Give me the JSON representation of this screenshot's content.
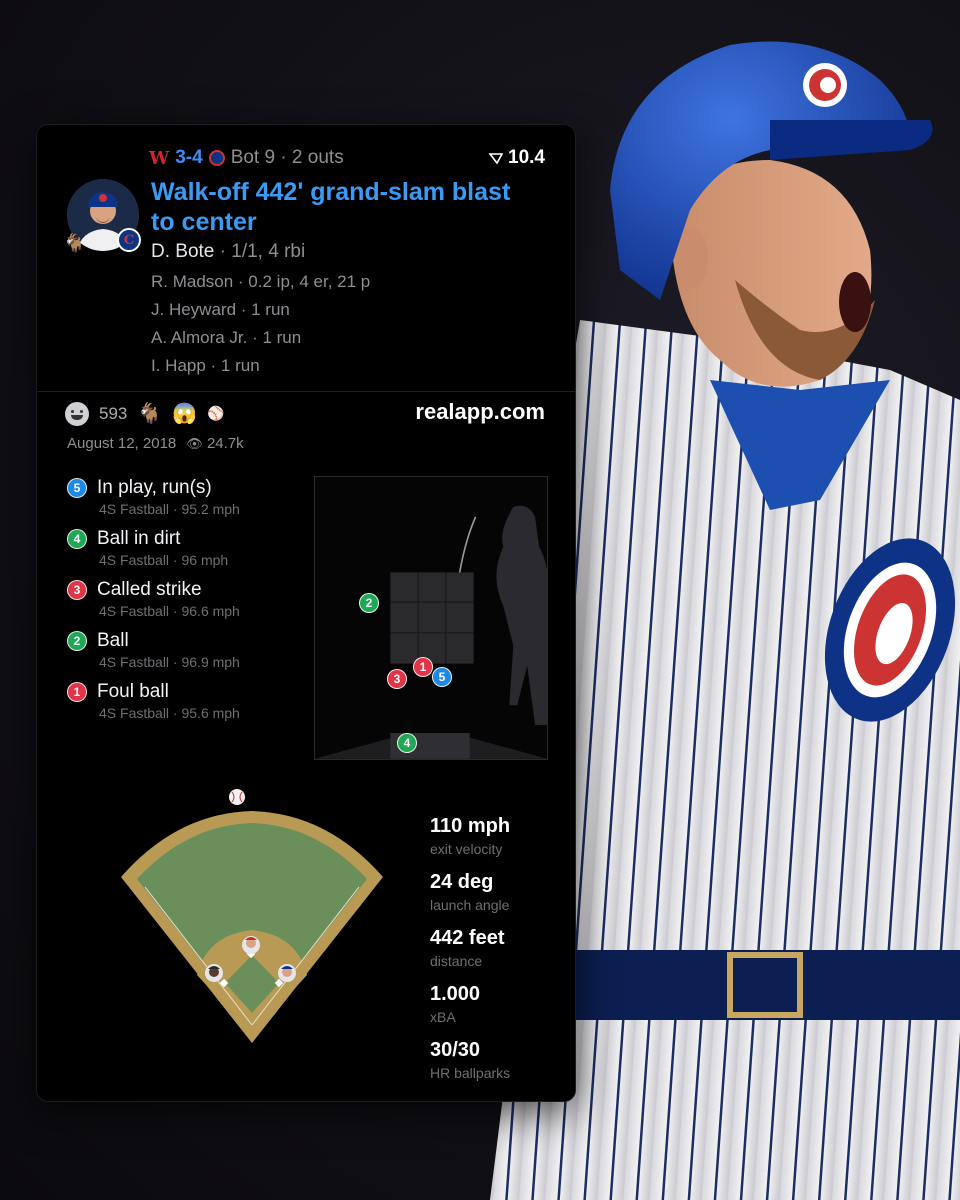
{
  "colors": {
    "accent_blue": "#3a9bf5",
    "in_play": "#1e88e5",
    "ball": "#1fa855",
    "strike": "#e03448",
    "cubs_blue": "#0e3386",
    "cubs_red": "#cc3433"
  },
  "header": {
    "away_logo": "W",
    "score": "3-4",
    "inning": "Bot 9 · 2 outs",
    "leverage_icon": "leverage-icon",
    "leverage": "10.4",
    "headline": "Walk-off 442' grand-slam blast to center",
    "team_badge": "C",
    "batter": {
      "name": "D. Bote",
      "line": "· 1/1, 4 rbi"
    },
    "others": [
      "R. Madson · 0.2 ip, 4 er, 21 p",
      "J. Heyward · 1 run",
      "A. Almora Jr. · 1 run",
      "I. Happ · 1 run"
    ]
  },
  "social": {
    "reactions": "593",
    "site": "realapp.com",
    "date": "August 12, 2018",
    "views": "24.7k"
  },
  "pitches": [
    {
      "num": "5",
      "result": "In play, run(s)",
      "desc": "4S Fastball · 95.2 mph",
      "kind": "in_play"
    },
    {
      "num": "4",
      "result": "Ball in dirt",
      "desc": "4S Fastball · 96 mph",
      "kind": "ball"
    },
    {
      "num": "3",
      "result": "Called strike",
      "desc": "4S Fastball · 96.6 mph",
      "kind": "strike"
    },
    {
      "num": "2",
      "result": "Ball",
      "desc": "4S Fastball · 96.9 mph",
      "kind": "ball"
    },
    {
      "num": "1",
      "result": "Foul ball",
      "desc": "4S Fastball · 95.6 mph",
      "kind": "strike"
    }
  ],
  "stats": [
    {
      "value": "110 mph",
      "label": "exit velocity"
    },
    {
      "value": "24 deg",
      "label": "launch angle"
    },
    {
      "value": "442 feet",
      "label": "distance"
    },
    {
      "value": "1.000",
      "label": "xBA"
    },
    {
      "value": "30/30",
      "label": "HR ballparks"
    }
  ]
}
